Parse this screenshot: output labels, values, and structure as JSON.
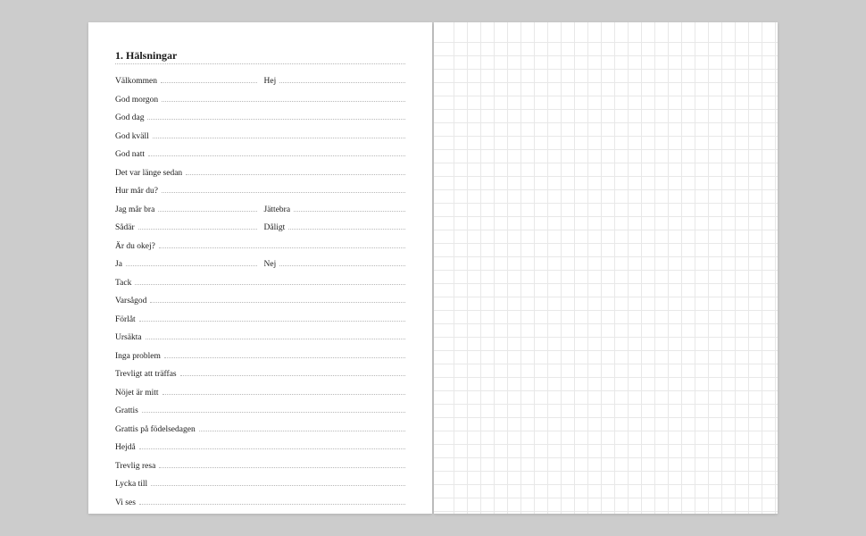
{
  "title": "1. Hälsningar",
  "rows": [
    {
      "type": "double",
      "a": "Välkommen",
      "b": "Hej"
    },
    {
      "type": "single",
      "a": "God morgon"
    },
    {
      "type": "single",
      "a": "God dag"
    },
    {
      "type": "single",
      "a": "God kväll"
    },
    {
      "type": "single",
      "a": "God natt"
    },
    {
      "type": "single",
      "a": "Det var länge sedan"
    },
    {
      "type": "single",
      "a": "Hur mår du?"
    },
    {
      "type": "double",
      "a": "Jag mår bra",
      "b": "Jättebra"
    },
    {
      "type": "double",
      "a": "Sådär",
      "b": "Dåligt"
    },
    {
      "type": "single",
      "a": "Är du okej?"
    },
    {
      "type": "double",
      "a": "Ja",
      "b": "Nej"
    },
    {
      "type": "single",
      "a": "Tack"
    },
    {
      "type": "single",
      "a": "Varsågod"
    },
    {
      "type": "single",
      "a": "Förlåt"
    },
    {
      "type": "single",
      "a": "Ursäkta"
    },
    {
      "type": "single",
      "a": "Inga problem"
    },
    {
      "type": "single",
      "a": "Trevligt att träffas"
    },
    {
      "type": "single",
      "a": "Nöjet är mitt"
    },
    {
      "type": "single",
      "a": "Grattis"
    },
    {
      "type": "single",
      "a": "Grattis på födelsedagen"
    },
    {
      "type": "single",
      "a": "Hejdå"
    },
    {
      "type": "single",
      "a": "Trevlig resa"
    },
    {
      "type": "single",
      "a": "Lycka till"
    },
    {
      "type": "single",
      "a": "Vi ses"
    }
  ]
}
